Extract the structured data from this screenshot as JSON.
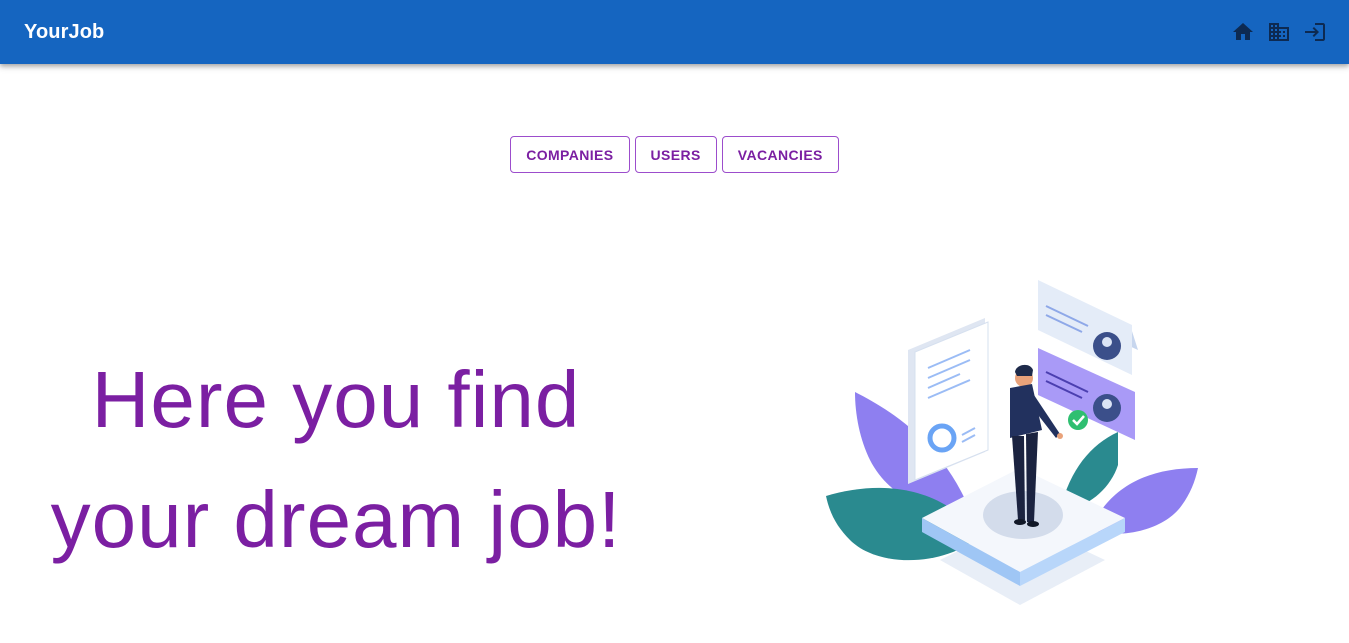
{
  "appbar": {
    "brand": "YourJob",
    "icons": [
      "home-icon",
      "business-icon",
      "login-icon"
    ],
    "color": "#1565c0"
  },
  "nav_buttons": {
    "companies": "COMPANIES",
    "users": "USERS",
    "vacancies": "VACANCIES"
  },
  "hero": {
    "line1": "Here you find",
    "line2": "your dream job!"
  },
  "colors": {
    "accent": "#7b1fa2",
    "appbar": "#1565c0"
  }
}
